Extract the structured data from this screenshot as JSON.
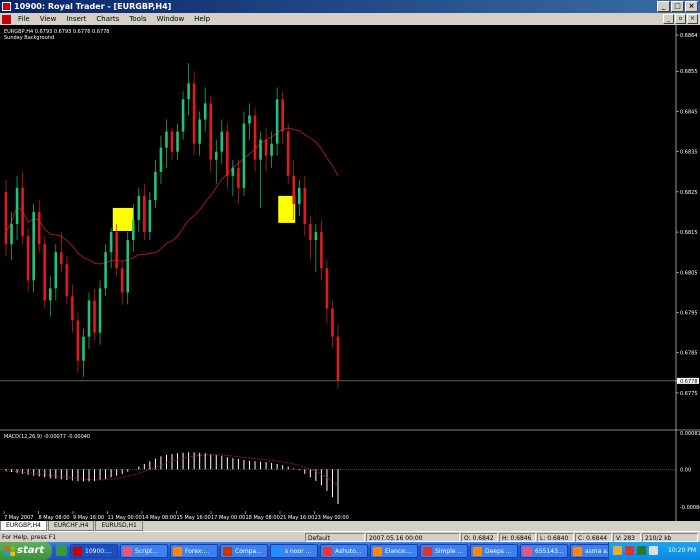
{
  "window": {
    "title": "10900: Royal Trader - [EURGBP,H4]"
  },
  "menu": {
    "items": [
      "File",
      "View",
      "Insert",
      "Charts",
      "Tools",
      "Window",
      "Help"
    ]
  },
  "chart": {
    "header": "EURGBP,H4  0.6793 0.6793 0.6776 0.6778",
    "indicator_label": "Sunday Background",
    "price_ticks": [
      "0.6864",
      "0.6855",
      "0.6845",
      "0.6835",
      "0.6825",
      "0.6815",
      "0.6805",
      "0.6795",
      "0.6785",
      "0.6778",
      "0.6775"
    ],
    "current_price": "0.6778",
    "date_ticks": [
      "7 May 2007",
      "8 May 08:00",
      "9 May 16:00",
      "11 May 00:00",
      "14 May 08:00",
      "15 May 16:00",
      "17 May 00:00",
      "18 May 08:00",
      "21 May 16:00",
      "23 May 00:00"
    ],
    "macd_label": "MACD(12,26,9) -0.00077 -0.00040",
    "macd_ticks": [
      "0.00081",
      "0.00",
      "-0.00084"
    ],
    "colors": {
      "bull": "#22c27a",
      "bear": "#e01b1b",
      "ma": "#c01f2a",
      "highlight": "#ffff00",
      "bg": "#000000"
    }
  },
  "chart_data": {
    "type": "candlestick",
    "series": [
      {
        "name": "EURGBP,H4",
        "values": [
          [
            0.6825,
            0.6828,
            0.6809,
            0.6812
          ],
          [
            0.6812,
            0.682,
            0.6808,
            0.6817
          ],
          [
            0.6817,
            0.6829,
            0.6813,
            0.6826
          ],
          [
            0.6826,
            0.683,
            0.6812,
            0.6814
          ],
          [
            0.6814,
            0.6816,
            0.68,
            0.6803
          ],
          [
            0.6803,
            0.6822,
            0.68,
            0.682
          ],
          [
            0.682,
            0.6823,
            0.681,
            0.6812
          ],
          [
            0.6812,
            0.6814,
            0.6796,
            0.6798
          ],
          [
            0.6798,
            0.6804,
            0.6794,
            0.6801
          ],
          [
            0.6801,
            0.6812,
            0.6798,
            0.681
          ],
          [
            0.681,
            0.6815,
            0.6805,
            0.6807
          ],
          [
            0.6807,
            0.6809,
            0.6797,
            0.6799
          ],
          [
            0.6799,
            0.6802,
            0.679,
            0.6793
          ],
          [
            0.6793,
            0.6795,
            0.678,
            0.6783
          ],
          [
            0.6783,
            0.6791,
            0.6779,
            0.6789
          ],
          [
            0.6789,
            0.68,
            0.6786,
            0.6798
          ],
          [
            0.6798,
            0.6801,
            0.6788,
            0.679
          ],
          [
            0.679,
            0.6803,
            0.6787,
            0.6801
          ],
          [
            0.6801,
            0.6812,
            0.6799,
            0.681
          ],
          [
            0.681,
            0.6816,
            0.6806,
            0.6815
          ],
          [
            0.6815,
            0.6817,
            0.6804,
            0.6806
          ],
          [
            0.6806,
            0.6808,
            0.6797,
            0.68
          ],
          [
            0.68,
            0.6815,
            0.6797,
            0.6813
          ],
          [
            0.6813,
            0.6822,
            0.681,
            0.6818
          ],
          [
            0.6818,
            0.6826,
            0.6815,
            0.6824
          ],
          [
            0.6824,
            0.6827,
            0.6813,
            0.6815
          ],
          [
            0.6815,
            0.6825,
            0.6813,
            0.6823
          ],
          [
            0.6823,
            0.6833,
            0.6821,
            0.683
          ],
          [
            0.683,
            0.6839,
            0.6827,
            0.6836
          ],
          [
            0.6836,
            0.6843,
            0.6831,
            0.684
          ],
          [
            0.684,
            0.6841,
            0.6833,
            0.6835
          ],
          [
            0.6835,
            0.6842,
            0.6833,
            0.684
          ],
          [
            0.684,
            0.685,
            0.6838,
            0.6848
          ],
          [
            0.6848,
            0.6857,
            0.6844,
            0.6852
          ],
          [
            0.6852,
            0.6855,
            0.6834,
            0.6837
          ],
          [
            0.6837,
            0.6845,
            0.6834,
            0.6843
          ],
          [
            0.6843,
            0.6851,
            0.684,
            0.6847
          ],
          [
            0.6847,
            0.6849,
            0.683,
            0.6833
          ],
          [
            0.6833,
            0.6838,
            0.6827,
            0.6835
          ],
          [
            0.6835,
            0.6843,
            0.6832,
            0.684
          ],
          [
            0.684,
            0.6842,
            0.6826,
            0.6829
          ],
          [
            0.6829,
            0.6833,
            0.6824,
            0.6831
          ],
          [
            0.6831,
            0.6833,
            0.6822,
            0.6826
          ],
          [
            0.6826,
            0.6845,
            0.6824,
            0.6842
          ],
          [
            0.6842,
            0.6847,
            0.6838,
            0.6844
          ],
          [
            0.6844,
            0.6846,
            0.683,
            0.6833
          ],
          [
            0.6833,
            0.684,
            0.6821,
            0.6838
          ],
          [
            0.6838,
            0.6841,
            0.683,
            0.6834
          ],
          [
            0.6834,
            0.684,
            0.6831,
            0.6837
          ],
          [
            0.6837,
            0.6851,
            0.6834,
            0.6848
          ],
          [
            0.6848,
            0.685,
            0.6837,
            0.684
          ],
          [
            0.684,
            0.6842,
            0.6827,
            0.6829
          ],
          [
            0.6829,
            0.6833,
            0.6818,
            0.6822
          ],
          [
            0.6822,
            0.6828,
            0.6819,
            0.6826
          ],
          [
            0.6826,
            0.6829,
            0.6814,
            0.6817
          ],
          [
            0.6817,
            0.6819,
            0.6808,
            0.6813
          ],
          [
            0.6813,
            0.6817,
            0.6805,
            0.6815
          ],
          [
            0.6815,
            0.6818,
            0.6803,
            0.6806
          ],
          [
            0.6806,
            0.6808,
            0.6792,
            0.6796
          ],
          [
            0.6796,
            0.6798,
            0.6786,
            0.6789
          ],
          [
            0.6789,
            0.6792,
            0.6776,
            0.6778
          ]
        ]
      }
    ],
    "macd_histogram": [
      -4e-05,
      -6e-05,
      -8e-05,
      -0.0001,
      -0.00012,
      -0.00014,
      -0.00016,
      -0.00018,
      -0.0002,
      -0.00021,
      -0.00022,
      -0.00024,
      -0.00025,
      -0.00026,
      -0.00027,
      -0.00027,
      -0.00026,
      -0.00024,
      -0.00022,
      -0.00018,
      -0.00014,
      -0.0001,
      -5e-05,
      0.0,
      6e-05,
      0.00012,
      0.00018,
      0.00024,
      0.00029,
      0.00032,
      0.00034,
      0.00036,
      0.00037,
      0.00038,
      0.00038,
      0.00037,
      0.00036,
      0.00034,
      0.00032,
      0.0003,
      0.00027,
      0.00025,
      0.00023,
      0.00021,
      0.00019,
      0.00018,
      0.00017,
      0.00016,
      0.00014,
      0.00012,
      9e-05,
      6e-05,
      2e-05,
      -2e-05,
      -0.0001,
      -0.00018,
      -0.00026,
      -0.00036,
      -0.00048,
      -0.00062,
      -0.00077
    ],
    "ylim": [
      0.6772,
      0.6866
    ]
  },
  "tabs": [
    "EURGBP,H4",
    "EURCHF,H4",
    "EURUSD,H1"
  ],
  "status": {
    "help": "For Help, press F1",
    "profile": "Default",
    "time": "2007.05.16 00:00",
    "open": "O: 0.6842",
    "high": "H: 0.6846",
    "low": "L: 0.6840",
    "close": "C: 0.6844",
    "volume": "V: 283",
    "traffic": "210/2 kb"
  },
  "taskbar": {
    "start": "start",
    "buttons": [
      "10900:...",
      "Script...",
      "Forex:...",
      "Compa...",
      "s noor ...",
      "Ashuto...",
      "Elance:...",
      "Simple ...",
      "Deeps ...",
      "655143...",
      "asma a..."
    ],
    "clock": "10:20 PM"
  }
}
